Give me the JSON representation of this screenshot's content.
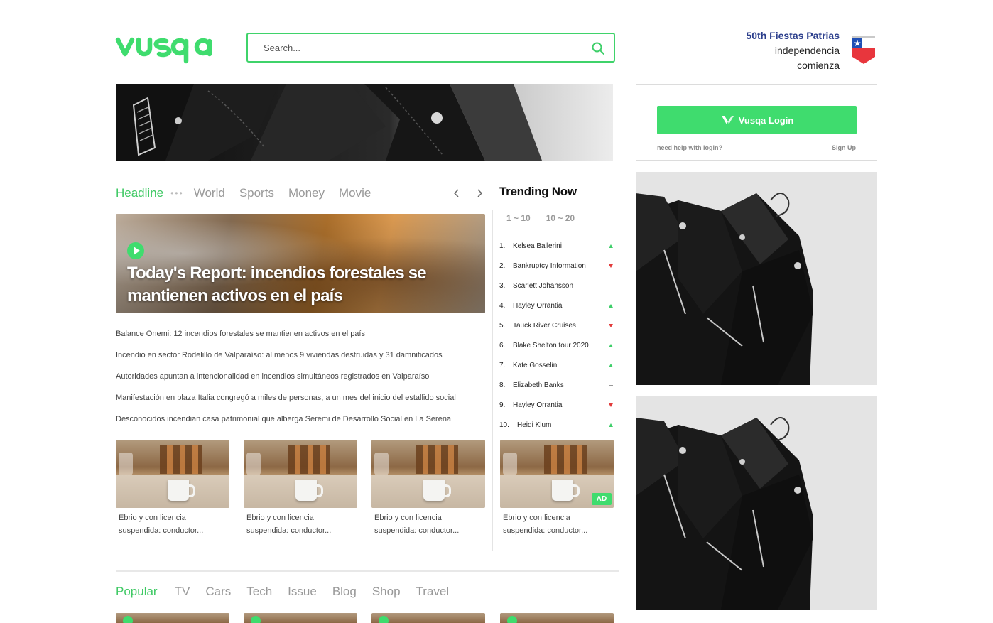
{
  "brand": {
    "logo_text": "vusqa",
    "accent": "#3fdc6e"
  },
  "search": {
    "placeholder": "Search..."
  },
  "promo": {
    "title": "50th Fiestas Patrias",
    "line1": "independencia",
    "line2": "comienza"
  },
  "login": {
    "button_label": "Vusqa Login",
    "help_label": "need help with login?",
    "signup_label": "Sign Up"
  },
  "tabs": {
    "items": [
      "Headline",
      "World",
      "Sports",
      "Money",
      "Movie"
    ],
    "active": "Headline"
  },
  "featured": {
    "title": "Today's Report: incendios forestales se mantienen activos en el país"
  },
  "headlines": [
    "Balance Onemi: 12 incendios forestales se mantienen activos en el país",
    "Incendio en sector Rodelillo de Valparaíso: al menos 9 viviendas destruidas y 31 damnificados",
    "Autoridades apuntan a intencionalidad en incendios simultáneos registrados en Valparaíso",
    "Manifestación en plaza Italia congregó a miles de personas, a un mes del inicio del estallido social",
    "Desconocidos incendian casa patrimonial que alberga Seremi de Desarrollo Social en La Serena"
  ],
  "thumbs": [
    {
      "line1": "Ebrio y con licencia",
      "line2": "suspendida: conductor...",
      "ad": ""
    },
    {
      "line1": "Ebrio y con licencia",
      "line2": "suspendida: conductor...",
      "ad": ""
    },
    {
      "line1": "Ebrio y con licencia",
      "line2": "suspendida: conductor...",
      "ad": ""
    },
    {
      "line1": "Ebrio y con licencia",
      "line2": "suspendida: conductor...",
      "ad": "AD"
    }
  ],
  "trending": {
    "title": "Trending Now",
    "ranges": [
      "1 ~ 10",
      "10 ~ 20"
    ],
    "items": [
      {
        "rank": "1.",
        "name": "Kelsea Ballerini",
        "trend": "up"
      },
      {
        "rank": "2.",
        "name": "Bankruptcy Information",
        "trend": "down"
      },
      {
        "rank": "3.",
        "name": "Scarlett Johansson",
        "trend": "flat"
      },
      {
        "rank": "4.",
        "name": "Hayley Orrantia",
        "trend": "up"
      },
      {
        "rank": "5.",
        "name": "Tauck River Cruises",
        "trend": "down"
      },
      {
        "rank": "6.",
        "name": "Blake Shelton tour 2020",
        "trend": "up"
      },
      {
        "rank": "7.",
        "name": "Kate Gosselin",
        "trend": "up"
      },
      {
        "rank": "8.",
        "name": "Elizabeth Banks",
        "trend": "flat"
      },
      {
        "rank": "9.",
        "name": "Hayley Orrantia",
        "trend": "down"
      },
      {
        "rank": "10.",
        "name": "Heidi Klum",
        "trend": "up"
      }
    ]
  },
  "popular": {
    "items": [
      "Popular",
      "TV",
      "Cars",
      "Tech",
      "Issue",
      "Blog",
      "Shop",
      "Travel"
    ],
    "active": "Popular"
  }
}
